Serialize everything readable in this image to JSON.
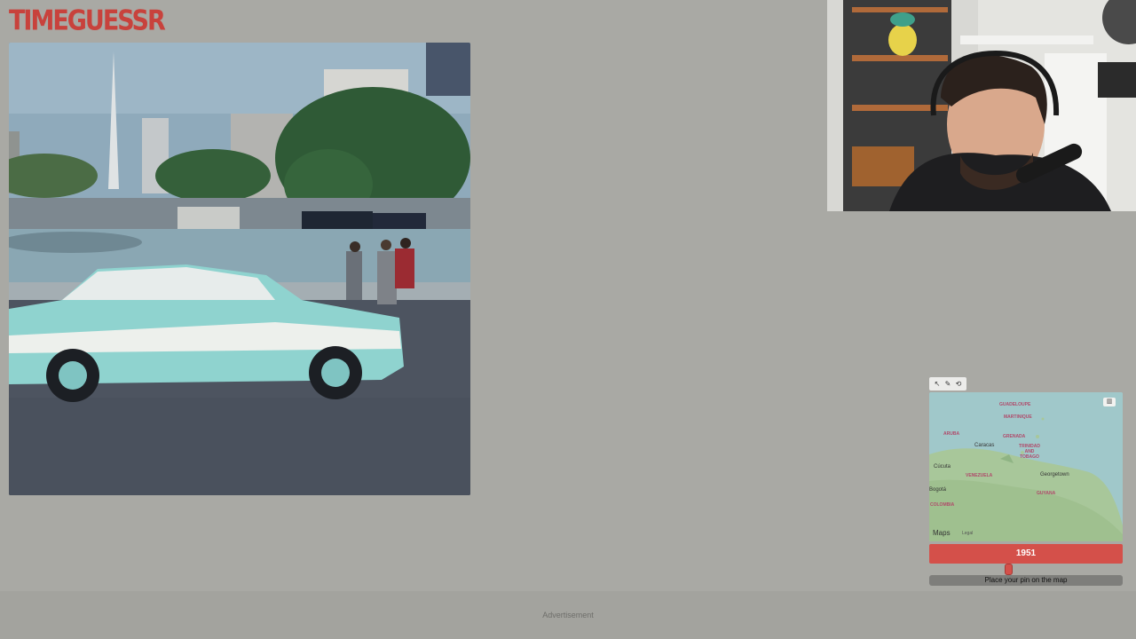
{
  "app": {
    "logo_text": "TIMEGUESSR"
  },
  "photo": {
    "alt": "Historic street scene"
  },
  "map": {
    "tools": [
      "↖",
      "✎",
      "⟲"
    ],
    "layers_icon": "layers-icon",
    "regions": [
      "GUADELOUPE",
      "MARTINIQUE",
      "ARUBA",
      "GRENADA",
      "TRINIDAD AND TOBAGO",
      "VENEZUELA",
      "GUYANA",
      "COLOMBIA"
    ],
    "cities": [
      "Caracas",
      "Cúcuta",
      "Bogotá",
      "Georgetown"
    ],
    "brand": " Maps",
    "legal": "Legal"
  },
  "year_slider": {
    "value": "1951",
    "fraction": 0.4
  },
  "submit": {
    "label": "Place your pin on the map"
  },
  "ad": {
    "label": "Advertisement"
  },
  "colors": {
    "brand": "#c8423c",
    "accent": "#d4504a",
    "background": "#a9a9a4"
  }
}
